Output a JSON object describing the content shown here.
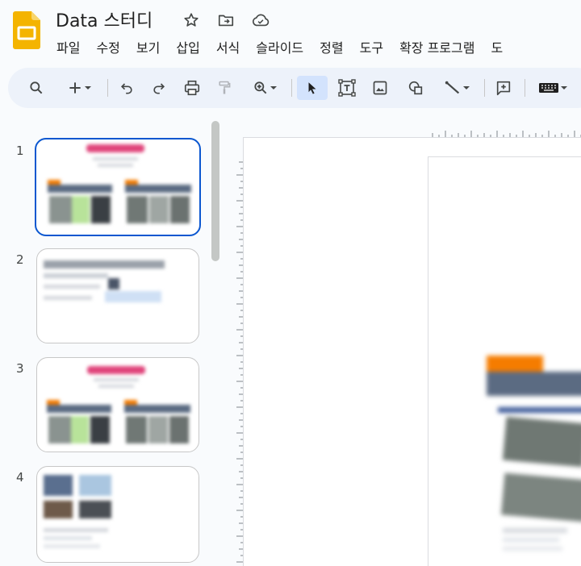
{
  "app": {
    "title": "Data 스터디"
  },
  "menu": [
    "파일",
    "수정",
    "보기",
    "삽입",
    "서식",
    "슬라이드",
    "정렬",
    "도구",
    "확장 프로그램",
    "도"
  ],
  "toolbar": {
    "buttons": [
      "search-icon",
      "plus-icon",
      "undo-icon",
      "redo-icon",
      "print-icon",
      "paint-format-icon",
      "zoom-icon",
      "select-cursor-icon",
      "text-box-icon",
      "image-icon",
      "shape-icon",
      "line-icon",
      "comment-icon",
      "keyboard-icon"
    ]
  },
  "slides": [
    {
      "number": "1",
      "selected": true
    },
    {
      "number": "2",
      "selected": false
    },
    {
      "number": "3",
      "selected": false
    },
    {
      "number": "4",
      "selected": false
    }
  ],
  "colors": {
    "accent_blue": "#0b57d0",
    "logo_yellow": "#f4b400",
    "thumb_pink": "#e0457b",
    "thumb_orange": "#f57c00",
    "thumb_navy": "#5b6b82"
  }
}
